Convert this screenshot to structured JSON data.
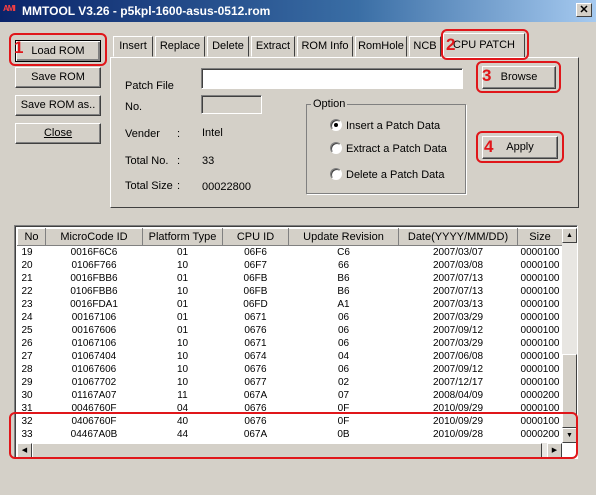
{
  "window": {
    "title": "MMTOOL V3.26 - p5kpl-1600-asus-0512.rom",
    "app_icon_text": "AMI",
    "close_glyph": "✕"
  },
  "buttons": {
    "load_rom": "Load ROM",
    "save_rom": "Save ROM",
    "save_rom_as": "Save ROM as..",
    "close": "Close"
  },
  "tabs": [
    "Insert",
    "Replace",
    "Delete",
    "Extract",
    "ROM Info",
    "RomHole",
    "NCB",
    "CPU PATCH"
  ],
  "panel": {
    "patch_file_label": "Patch File",
    "patch_file_value": "",
    "no_label": "No.",
    "browse": "Browse",
    "apply": "Apply",
    "vender_label": "Vender",
    "vender_colon": ":",
    "vender_value": "Intel",
    "total_no_label": "Total No.",
    "total_no_colon": ":",
    "total_no_value": "33",
    "total_size_label": "Total Size",
    "total_size_colon": ":",
    "total_size_value": "00022800",
    "option_label": "Option",
    "options": [
      "Insert a Patch Data",
      "Extract a Patch Data",
      "Delete a Patch Data"
    ],
    "selected_option": 0
  },
  "annotations": [
    "1",
    "2",
    "3",
    "4"
  ],
  "table": {
    "columns": [
      "No",
      "MicroCode ID",
      "Platform Type",
      "CPU ID",
      "Update Revision",
      "Date(YYYY/MM/DD)",
      "Size"
    ],
    "rows": [
      [
        "19",
        "0016F6C6",
        "01",
        "06F6",
        "C6",
        "2007/03/07",
        "0000100"
      ],
      [
        "20",
        "0106F766",
        "10",
        "06F7",
        "66",
        "2007/03/08",
        "0000100"
      ],
      [
        "21",
        "0016FBB6",
        "01",
        "06FB",
        "B6",
        "2007/07/13",
        "0000100"
      ],
      [
        "22",
        "0106FBB6",
        "10",
        "06FB",
        "B6",
        "2007/07/13",
        "0000100"
      ],
      [
        "23",
        "0016FDA1",
        "01",
        "06FD",
        "A1",
        "2007/03/13",
        "0000100"
      ],
      [
        "24",
        "00167106",
        "01",
        "0671",
        "06",
        "2007/03/29",
        "0000100"
      ],
      [
        "25",
        "00167606",
        "01",
        "0676",
        "06",
        "2007/09/12",
        "0000100"
      ],
      [
        "26",
        "01067106",
        "10",
        "0671",
        "06",
        "2007/03/29",
        "0000100"
      ],
      [
        "27",
        "01067404",
        "10",
        "0674",
        "04",
        "2007/06/08",
        "0000100"
      ],
      [
        "28",
        "01067606",
        "10",
        "0676",
        "06",
        "2007/09/12",
        "0000100"
      ],
      [
        "29",
        "01067702",
        "10",
        "0677",
        "02",
        "2007/12/17",
        "0000100"
      ],
      [
        "30",
        "01167A07",
        "11",
        "067A",
        "07",
        "2008/04/09",
        "0000200"
      ],
      [
        "31",
        "0046760F",
        "04",
        "0676",
        "0F",
        "2010/09/29",
        "0000100"
      ],
      [
        "32",
        "0406760F",
        "40",
        "0676",
        "0F",
        "2010/09/29",
        "0000100"
      ],
      [
        "33",
        "04467A0B",
        "44",
        "067A",
        "0B",
        "2010/09/28",
        "0000200"
      ]
    ]
  },
  "scroll": {
    "up_glyph": "▲",
    "down_glyph": "▼",
    "left_glyph": "◀",
    "right_glyph": "▶"
  },
  "colors": {
    "highlight": "#e0161a",
    "titlebar": "#0a246a"
  }
}
